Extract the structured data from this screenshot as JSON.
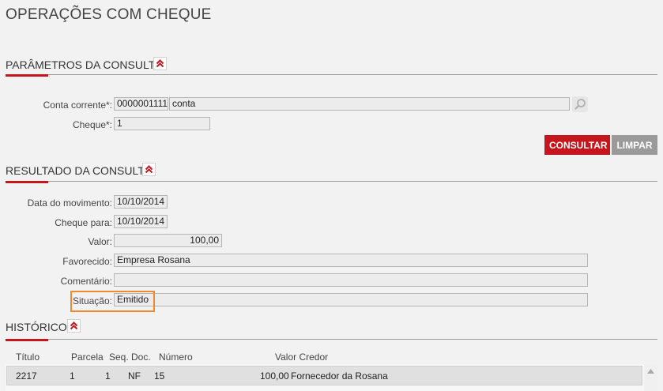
{
  "page": {
    "title": "OPERAÇÕES COM CHEQUE"
  },
  "params": {
    "title": "PARÂMETROS DA CONSULTA",
    "conta_label": "Conta corrente*:",
    "conta_number": "0000001111",
    "conta_name": "conta",
    "cheque_label": "Cheque*:",
    "cheque_value": "1",
    "consultar_label": "CONSULTAR",
    "limpar_label": "LIMPAR"
  },
  "result": {
    "title": "RESULTADO DA CONSULTA",
    "data_mov_label": "Data do movimento:",
    "data_mov_value": "10/10/2014",
    "cheque_para_label": "Cheque para:",
    "cheque_para_value": "10/10/2014",
    "valor_label": "Valor:",
    "valor_value": "100,00",
    "favorecido_label": "Favorecido:",
    "favorecido_value": "Empresa Rosana",
    "comentario_label": "Comentário:",
    "comentario_value": "",
    "situacao_label": "Situação:",
    "situacao_value": "Emitido"
  },
  "historico": {
    "title": "HISTÓRICO",
    "columns": {
      "titulo": "Título",
      "parcela": "Parcela",
      "seq": "Seq.",
      "doc": "Doc.",
      "numero": "Número",
      "valor_credor": "Valor Credor"
    },
    "rows": [
      {
        "titulo": "2217",
        "parcela": "1",
        "seq": "1",
        "doc": "NF",
        "numero": "15",
        "valor": "100,00",
        "credor": "Fornecedor da  Rosana"
      }
    ]
  },
  "colors": {
    "accent": "#c4161c",
    "highlight": "#f08a2c",
    "secondary_button": "#9a9a9a"
  },
  "icons": {
    "collapse": "double-chevron-up-icon",
    "search": "magnifier-icon",
    "scroll_up": "triangle-up-icon"
  }
}
